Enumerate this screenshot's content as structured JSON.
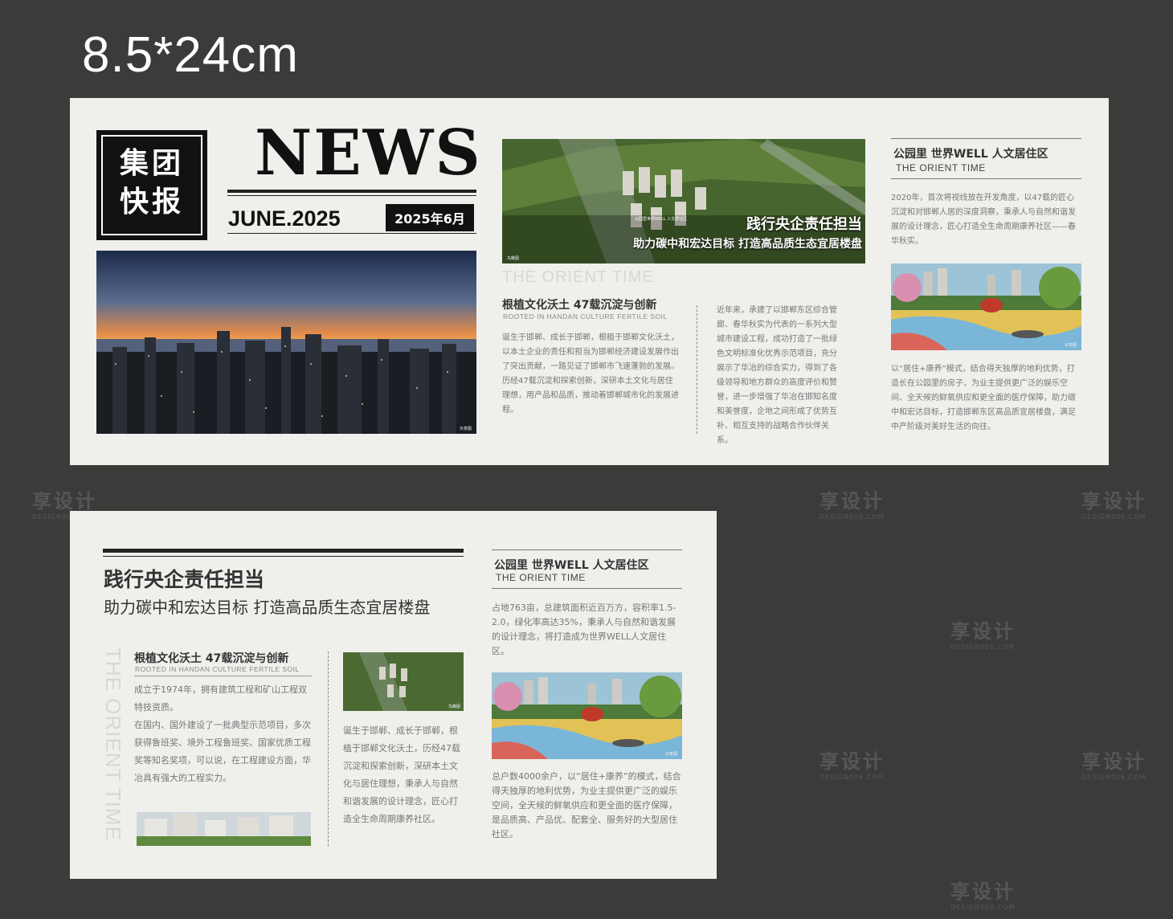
{
  "size_label": "8.5*24cm",
  "panel1": {
    "masthead": {
      "line1": "集团",
      "line2": "快报"
    },
    "news_word": "NEWS",
    "date_en": "JUNE.2025",
    "date_cn": "2025年6月",
    "city_caption": "示意图",
    "aerial": {
      "title": "践行央企责任担当",
      "subtitle": "助力碳中和宏达目标 打造高品质生态宜居楼盘",
      "left_caption": "鸟瞰图",
      "sign": "公园里世界WELL 人文居住区"
    },
    "ghost_heading": "THE ORIENT TIME",
    "article": {
      "title": "根植文化沃土 47载沉淀与创新",
      "subtitle": "ROOTED IN HANDAN CULTURE FERTILE SOIL",
      "col1_paragraphs": [
        "诞生于邯郸、成长于邯郸，根植于邯郸文化沃土，以本土企业的责任和担当为邯郸经济建设发展作出了突出贡献，一路见证了邯郸市飞速蓬勃的发展。",
        "历经47载沉淀和探索创新，深研本土文化与居住理想，用产品和品质，推动着邯郸城市化的发展进程。"
      ],
      "col2_paragraphs": [
        "近年来，承建了以邯郸东区综合管廊、春华秋实为代表的一系列大型城市建设工程，成功打造了一批绿色文明标准化优秀示范项目，充分展示了华冶的综合实力，得到了各级领导和地方群众的高度评价和赞誉，进一步增强了华冶在邯知名度和美誉度，企地之间形成了优势互补、相互支持的战略合作伙伴关系。"
      ]
    },
    "right": {
      "title": "公园里 世界WELL 人文居住区",
      "subtitle": "THE ORIENT TIME",
      "para1": "2020年，首次将视线放在开发角度，以47载的匠心沉淀和对邯郸人居的深度洞察，秉承人与自然和谐发展的设计理念，匠心打造全生命周期康养社区——春华秋实。",
      "image_caption": "示意图",
      "para2": "以“居住+康养”模式，结合得天独厚的地利优势，打造长在公园里的房子，为业主提供更广泛的娱乐空间、全天候的鲜氧供应和更全面的医疗保障，助力碳中和宏达目标，打造邯郸东区高品质宜居楼盘，满足中产阶级对美好生活的向往。"
    }
  },
  "panel2": {
    "title": "践行央企责任担当",
    "subtitle": "助力碳中和宏达目标 打造高品质生态宜居楼盘",
    "vertical_ghost": "THE ORIENT TIME",
    "article": {
      "title": "根植文化沃土 47载沉淀与创新",
      "subtitle": "ROOTED IN HANDAN CULTURE FERTILE SOIL",
      "paragraphs": [
        "成立于1974年，拥有建筑工程和矿山工程双特技资质。",
        "在国内、国外建设了一批典型示范项目，多次获得鲁班奖、境外工程鲁班奖、国家优质工程奖等知名奖项，可以说，在工程建设方面，华冶具有强大的工程实力。"
      ]
    },
    "mid": {
      "image_caption": "鸟瞰图",
      "text": "诞生于邯郸、成长于邯郸，根植于邯郸文化沃土，历经47载沉淀和探索创新，深研本土文化与居住理想，秉承人与自然和谐发展的设计理念，匠心打造全生命周期康养社区。"
    },
    "right": {
      "title": "公园里 世界WELL 人文居住区",
      "subtitle": "THE ORIENT TIME",
      "para1": "占地763亩，总建筑面积近百万方，容积率1.5-2.0，绿化率高达35%，秉承人与自然和谐发展的设计理念，将打造成为世界WELL人文居住区。",
      "image_caption": "示意图",
      "para2": "总户数4000余户，以“居住+康养”的模式，结合得天独厚的地利优势，为业主提供更广泛的娱乐空间，全天候的鲜氧供应和更全面的医疗保障，是品质高、产品优、配套全、服务好的大型居住社区。"
    }
  },
  "watermark": {
    "cn": "享设计",
    "en": "DESIGN006.COM"
  }
}
